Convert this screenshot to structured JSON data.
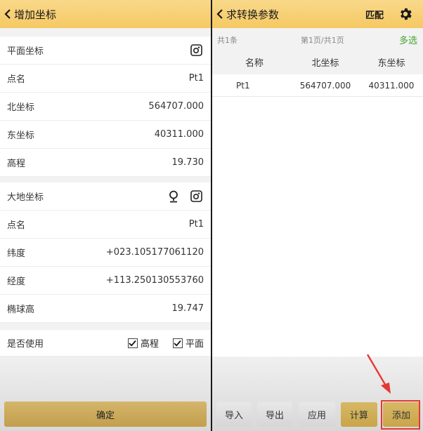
{
  "left": {
    "header": {
      "title": "增加坐标"
    },
    "plane": {
      "section_label": "平面坐标",
      "rows": [
        {
          "label": "点名",
          "value": "Pt1"
        },
        {
          "label": "北坐标",
          "value": "564707.000"
        },
        {
          "label": "东坐标",
          "value": "40311.000"
        },
        {
          "label": "高程",
          "value": "19.730"
        }
      ]
    },
    "geodetic": {
      "section_label": "大地坐标",
      "rows": [
        {
          "label": "点名",
          "value": "Pt1"
        },
        {
          "label": "纬度",
          "value": "+023.105177061120"
        },
        {
          "label": "经度",
          "value": "+113.250130553760"
        },
        {
          "label": "椭球高",
          "value": "19.747"
        }
      ]
    },
    "use": {
      "label": "是否使用",
      "check_height": "高程",
      "check_plane": "平面",
      "height_checked": true,
      "plane_checked": true
    },
    "confirm_label": "确定"
  },
  "right": {
    "header": {
      "title": "求转换参数",
      "match_label": "匹配",
      "settings_icon": "gear-icon"
    },
    "info": {
      "count": "共1条",
      "page": "第1页/共1页",
      "multi_select": "多选"
    },
    "table": {
      "columns": [
        "名称",
        "北坐标",
        "东坐标"
      ],
      "rows": [
        [
          "Pt1",
          "564707.000",
          "40311.000"
        ]
      ]
    },
    "toolbar": [
      "导入",
      "导出",
      "应用",
      "计算",
      "添加"
    ]
  },
  "colors": {
    "header": "#f5c863",
    "accent_gold": "#c9a54a",
    "multi_select": "#43a62e",
    "highlight": "#e53935"
  }
}
